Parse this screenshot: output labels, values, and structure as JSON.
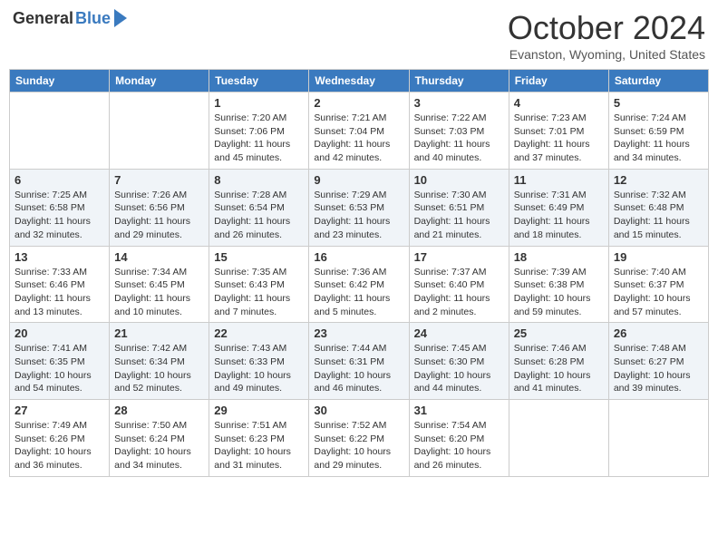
{
  "header": {
    "logo_general": "General",
    "logo_blue": "Blue",
    "title": "October 2024",
    "location": "Evanston, Wyoming, United States"
  },
  "days_of_week": [
    "Sunday",
    "Monday",
    "Tuesday",
    "Wednesday",
    "Thursday",
    "Friday",
    "Saturday"
  ],
  "weeks": [
    [
      {
        "day": "",
        "sunrise": "",
        "sunset": "",
        "daylight": ""
      },
      {
        "day": "",
        "sunrise": "",
        "sunset": "",
        "daylight": ""
      },
      {
        "day": "1",
        "sunrise": "Sunrise: 7:20 AM",
        "sunset": "Sunset: 7:06 PM",
        "daylight": "Daylight: 11 hours and 45 minutes."
      },
      {
        "day": "2",
        "sunrise": "Sunrise: 7:21 AM",
        "sunset": "Sunset: 7:04 PM",
        "daylight": "Daylight: 11 hours and 42 minutes."
      },
      {
        "day": "3",
        "sunrise": "Sunrise: 7:22 AM",
        "sunset": "Sunset: 7:03 PM",
        "daylight": "Daylight: 11 hours and 40 minutes."
      },
      {
        "day": "4",
        "sunrise": "Sunrise: 7:23 AM",
        "sunset": "Sunset: 7:01 PM",
        "daylight": "Daylight: 11 hours and 37 minutes."
      },
      {
        "day": "5",
        "sunrise": "Sunrise: 7:24 AM",
        "sunset": "Sunset: 6:59 PM",
        "daylight": "Daylight: 11 hours and 34 minutes."
      }
    ],
    [
      {
        "day": "6",
        "sunrise": "Sunrise: 7:25 AM",
        "sunset": "Sunset: 6:58 PM",
        "daylight": "Daylight: 11 hours and 32 minutes."
      },
      {
        "day": "7",
        "sunrise": "Sunrise: 7:26 AM",
        "sunset": "Sunset: 6:56 PM",
        "daylight": "Daylight: 11 hours and 29 minutes."
      },
      {
        "day": "8",
        "sunrise": "Sunrise: 7:28 AM",
        "sunset": "Sunset: 6:54 PM",
        "daylight": "Daylight: 11 hours and 26 minutes."
      },
      {
        "day": "9",
        "sunrise": "Sunrise: 7:29 AM",
        "sunset": "Sunset: 6:53 PM",
        "daylight": "Daylight: 11 hours and 23 minutes."
      },
      {
        "day": "10",
        "sunrise": "Sunrise: 7:30 AM",
        "sunset": "Sunset: 6:51 PM",
        "daylight": "Daylight: 11 hours and 21 minutes."
      },
      {
        "day": "11",
        "sunrise": "Sunrise: 7:31 AM",
        "sunset": "Sunset: 6:49 PM",
        "daylight": "Daylight: 11 hours and 18 minutes."
      },
      {
        "day": "12",
        "sunrise": "Sunrise: 7:32 AM",
        "sunset": "Sunset: 6:48 PM",
        "daylight": "Daylight: 11 hours and 15 minutes."
      }
    ],
    [
      {
        "day": "13",
        "sunrise": "Sunrise: 7:33 AM",
        "sunset": "Sunset: 6:46 PM",
        "daylight": "Daylight: 11 hours and 13 minutes."
      },
      {
        "day": "14",
        "sunrise": "Sunrise: 7:34 AM",
        "sunset": "Sunset: 6:45 PM",
        "daylight": "Daylight: 11 hours and 10 minutes."
      },
      {
        "day": "15",
        "sunrise": "Sunrise: 7:35 AM",
        "sunset": "Sunset: 6:43 PM",
        "daylight": "Daylight: 11 hours and 7 minutes."
      },
      {
        "day": "16",
        "sunrise": "Sunrise: 7:36 AM",
        "sunset": "Sunset: 6:42 PM",
        "daylight": "Daylight: 11 hours and 5 minutes."
      },
      {
        "day": "17",
        "sunrise": "Sunrise: 7:37 AM",
        "sunset": "Sunset: 6:40 PM",
        "daylight": "Daylight: 11 hours and 2 minutes."
      },
      {
        "day": "18",
        "sunrise": "Sunrise: 7:39 AM",
        "sunset": "Sunset: 6:38 PM",
        "daylight": "Daylight: 10 hours and 59 minutes."
      },
      {
        "day": "19",
        "sunrise": "Sunrise: 7:40 AM",
        "sunset": "Sunset: 6:37 PM",
        "daylight": "Daylight: 10 hours and 57 minutes."
      }
    ],
    [
      {
        "day": "20",
        "sunrise": "Sunrise: 7:41 AM",
        "sunset": "Sunset: 6:35 PM",
        "daylight": "Daylight: 10 hours and 54 minutes."
      },
      {
        "day": "21",
        "sunrise": "Sunrise: 7:42 AM",
        "sunset": "Sunset: 6:34 PM",
        "daylight": "Daylight: 10 hours and 52 minutes."
      },
      {
        "day": "22",
        "sunrise": "Sunrise: 7:43 AM",
        "sunset": "Sunset: 6:33 PM",
        "daylight": "Daylight: 10 hours and 49 minutes."
      },
      {
        "day": "23",
        "sunrise": "Sunrise: 7:44 AM",
        "sunset": "Sunset: 6:31 PM",
        "daylight": "Daylight: 10 hours and 46 minutes."
      },
      {
        "day": "24",
        "sunrise": "Sunrise: 7:45 AM",
        "sunset": "Sunset: 6:30 PM",
        "daylight": "Daylight: 10 hours and 44 minutes."
      },
      {
        "day": "25",
        "sunrise": "Sunrise: 7:46 AM",
        "sunset": "Sunset: 6:28 PM",
        "daylight": "Daylight: 10 hours and 41 minutes."
      },
      {
        "day": "26",
        "sunrise": "Sunrise: 7:48 AM",
        "sunset": "Sunset: 6:27 PM",
        "daylight": "Daylight: 10 hours and 39 minutes."
      }
    ],
    [
      {
        "day": "27",
        "sunrise": "Sunrise: 7:49 AM",
        "sunset": "Sunset: 6:26 PM",
        "daylight": "Daylight: 10 hours and 36 minutes."
      },
      {
        "day": "28",
        "sunrise": "Sunrise: 7:50 AM",
        "sunset": "Sunset: 6:24 PM",
        "daylight": "Daylight: 10 hours and 34 minutes."
      },
      {
        "day": "29",
        "sunrise": "Sunrise: 7:51 AM",
        "sunset": "Sunset: 6:23 PM",
        "daylight": "Daylight: 10 hours and 31 minutes."
      },
      {
        "day": "30",
        "sunrise": "Sunrise: 7:52 AM",
        "sunset": "Sunset: 6:22 PM",
        "daylight": "Daylight: 10 hours and 29 minutes."
      },
      {
        "day": "31",
        "sunrise": "Sunrise: 7:54 AM",
        "sunset": "Sunset: 6:20 PM",
        "daylight": "Daylight: 10 hours and 26 minutes."
      },
      {
        "day": "",
        "sunrise": "",
        "sunset": "",
        "daylight": ""
      },
      {
        "day": "",
        "sunrise": "",
        "sunset": "",
        "daylight": ""
      }
    ]
  ]
}
